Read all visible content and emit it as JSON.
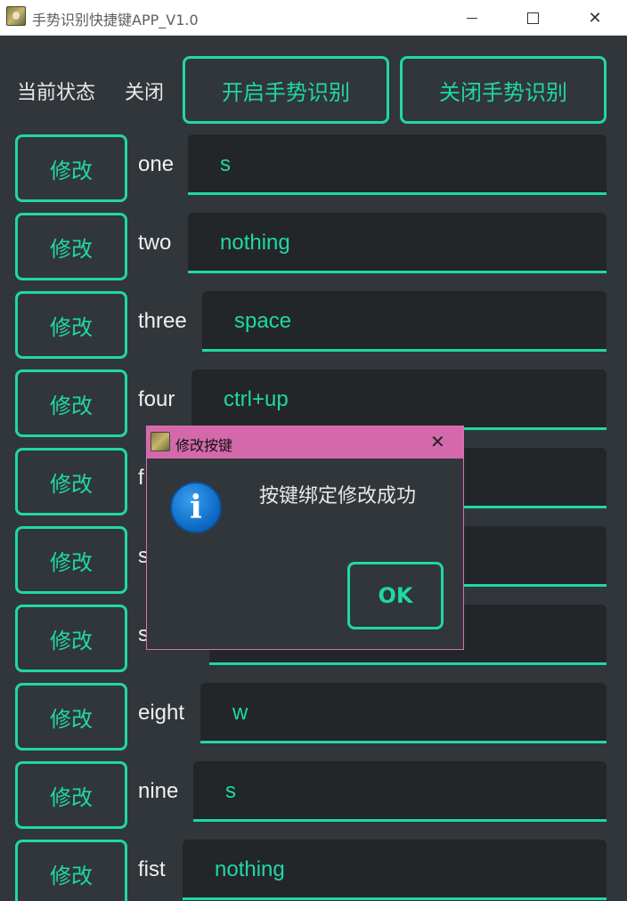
{
  "window": {
    "title": "手势识别快捷键APP_V1.0",
    "minimize": "—",
    "maximize": "□",
    "close": "✕"
  },
  "status": {
    "label": "当前状态",
    "value": "关闭"
  },
  "buttons": {
    "enable": "开启手势识别",
    "disable": "关闭手势识别",
    "edit": "修改"
  },
  "gestures": [
    {
      "name": "one",
      "value": "s"
    },
    {
      "name": "two",
      "value": "nothing"
    },
    {
      "name": "three",
      "value": "space"
    },
    {
      "name": "four",
      "value": "ctrl+up"
    },
    {
      "name": "f",
      "value": ""
    },
    {
      "name": "s",
      "value": ""
    },
    {
      "name": "s",
      "value": ""
    },
    {
      "name": "eight",
      "value": "w"
    },
    {
      "name": "nine",
      "value": "s"
    },
    {
      "name": "fist",
      "value": "nothing"
    }
  ],
  "dialog": {
    "title": "修改按键",
    "message": "按键绑定修改成功",
    "ok": "OK",
    "close": "✕",
    "info_icon": "i"
  },
  "colors": {
    "accent": "#1fd8a4",
    "background": "#31363b",
    "field": "#232629",
    "dialog_title": "#d369aa"
  }
}
